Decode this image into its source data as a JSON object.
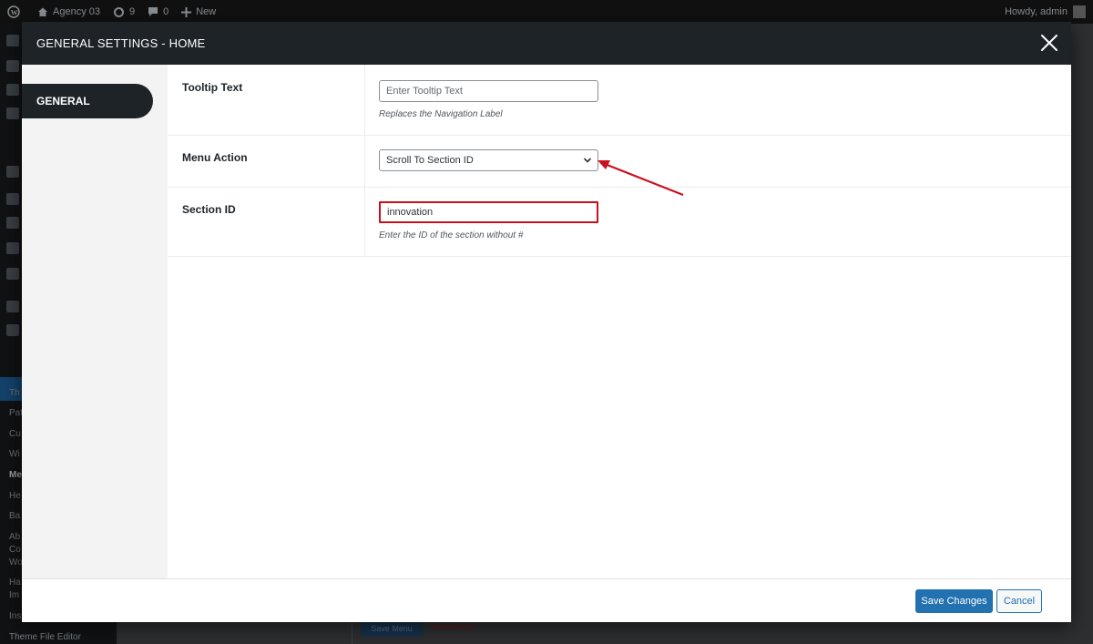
{
  "admin_bar": {
    "site_name": "Agency 03",
    "updates_count": "9",
    "comments_count": "0",
    "new_label": "New",
    "greeting": "Howdy, admin"
  },
  "bg_sidebar": {
    "submenu": [
      "Th",
      "Pat",
      "Cu",
      "Wi",
      "Me",
      "He",
      "Ba",
      "Ab",
      "Co",
      "Wo",
      "Ha",
      "Im",
      "Ins"
    ],
    "theme_file_editor": "Theme File Editor"
  },
  "bg_content": {
    "save_menu": "Save Menu",
    "delete_menu": "Delete Menu"
  },
  "modal": {
    "title": "GENERAL SETTINGS - HOME",
    "nav_tabs": [
      {
        "label": "GENERAL"
      }
    ],
    "fields": {
      "tooltip": {
        "label": "Tooltip Text",
        "value": "",
        "placeholder": "Enter Tooltip Text",
        "description": "Replaces the Navigation Label"
      },
      "menu_action": {
        "label": "Menu Action",
        "selected": "Scroll To Section ID"
      },
      "section_id": {
        "label": "Section ID",
        "value": "innovation",
        "description": "Enter the ID of the section without #"
      }
    },
    "footer": {
      "save_label": "Save Changes",
      "cancel_label": "Cancel"
    }
  },
  "colors": {
    "primary": "#2271b1",
    "header_bg": "#1d2327",
    "highlight": "#c9111e",
    "annotation_arrow": "#c9111e"
  },
  "icons": {
    "close": "close-icon",
    "chevron": "chevron-down-icon",
    "wordpress": "wordpress-logo-icon",
    "home": "home-icon",
    "updates": "updates-icon",
    "comments": "comments-icon",
    "plus": "plus-icon"
  }
}
